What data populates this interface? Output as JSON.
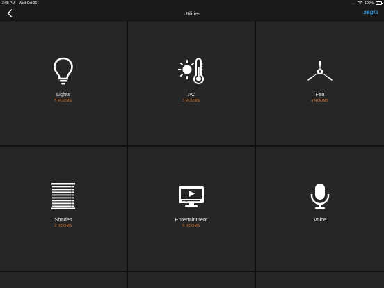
{
  "status": {
    "time": "2:05 PM",
    "date": "Wed Oct 31",
    "dots": "....",
    "battery": "100%"
  },
  "nav": {
    "title": "Utilities",
    "brand": "aegis"
  },
  "tiles": [
    {
      "label": "Lights",
      "sub": "5 ROOMS",
      "icon": "lightbulb-icon"
    },
    {
      "label": "AC",
      "sub": "3 ROOMS",
      "icon": "sun-thermometer-icon"
    },
    {
      "label": "Fan",
      "sub": "4 ROOMS",
      "icon": "fan-icon"
    },
    {
      "label": "Shades",
      "sub": "2 ROOMS",
      "icon": "window-blinds-icon"
    },
    {
      "label": "Entertainment",
      "sub": "5 ROOMS",
      "icon": "tv-play-icon"
    },
    {
      "label": "Voice",
      "sub": "",
      "icon": "microphone-icon"
    }
  ],
  "colors": {
    "accent": "#e2772e",
    "brand": "#2f8fd8",
    "tile": "#262626",
    "background": "#111111"
  }
}
